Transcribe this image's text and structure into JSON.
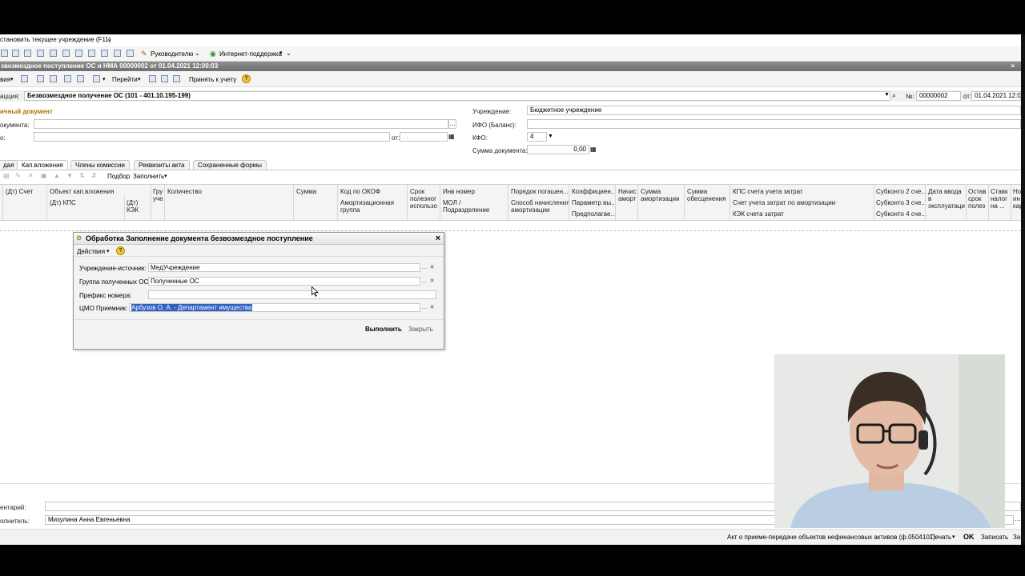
{
  "menu": {
    "restore_institution": "становить текущее учреждение (F11)"
  },
  "toolbar1": {
    "manager": "Руководителю",
    "support": "Интернет-поддержка"
  },
  "document": {
    "title": "звозмездное поступление ОС и НМА 00000002 от 01.04.2021 12:00:03",
    "actions_label": "вия",
    "goto_label": "Перейти",
    "accept_label": "Принять к учету",
    "operation_label": "ацция:",
    "operation_value": "Безвозмездное получение ОС (101 - 401.10.195-199)",
    "number_label": "№:",
    "number_value": "00000002",
    "date_label": "от:",
    "date_value": "01.04.2021 12:00:",
    "primary_doc_section": "ичный документ",
    "doc_label": "окумента:",
    "from_short_label": "о:",
    "from_label": "от:",
    "date_placeholder": ". .",
    "institution_label": "Учреждение:",
    "institution_value": "Бюджетное учреждение",
    "ifo_label": "ИФО (Баланс):",
    "kfo_label": "КФО:",
    "kfo_value": "4",
    "sum_label": "Сумма документа:",
    "sum_value": "0,00"
  },
  "tabs": [
    {
      "label": "дая"
    },
    {
      "label": "Кап.вложения"
    },
    {
      "label": "Члены комиссии"
    },
    {
      "label": "Реквизиты акта"
    },
    {
      "label": "Сохраненные формы"
    }
  ],
  "tabtoolbar": {
    "pick": "Подбор",
    "fill": "Заполнить"
  },
  "grid_headers": {
    "c1a": "(Дт) Счет",
    "c2a": "Объект кап.вложения",
    "c2b": "(Дт) КПС",
    "c3a": "(Дт)",
    "c3b": "КЭК",
    "c4a": "Гру",
    "c4b": "уче",
    "c5a": "Количество",
    "c6a": "Сумма",
    "c7a": "Код по ОКОФ",
    "c7b": "Амортизационная",
    "c7c": "группа",
    "c8a": "Срок",
    "c8b": "полезног",
    "c8c": "использо",
    "c9a": "Инв номер",
    "c9b": "МОЛ /",
    "c9c": "Подразделение",
    "c10a": "Порядок погашен...",
    "c10b": "Способ начисления",
    "c10c": "амортизации",
    "c11a": "Коэффициен...",
    "c11b": "Параметр вы...",
    "c11c": "Предполагае...",
    "c12a": "Начис",
    "c12b": "аморт",
    "c13a": "Сумма",
    "c13b": "амортизации",
    "c14a": "Сумма",
    "c14b": "обесценения",
    "c15a": "КПС счета учета затрат",
    "c15b": "Счет учета затрат по амортизации",
    "c15c": "КЭК счета затрат",
    "c16a": "Субконто 2 сче...",
    "c16b": "Субконто 3 сче...",
    "c16c": "Субконто 4 сче...",
    "c17a": "Дата ввода",
    "c17b": "в",
    "c17c": "эксплуатаци",
    "c18a": "Остав",
    "c18b": "срок",
    "c18c": "полез",
    "c19a": "Ставк",
    "c19b": "налог",
    "c19c": "на ...",
    "c20a": "Но",
    "c20b": "ин",
    "c20c": "кар"
  },
  "dialog": {
    "title": "Обработка  Заполнение документа безвозмездное поступление",
    "actions": "Действия",
    "source_label": "Учреждение-источник:",
    "source_value": "МедУчреждение",
    "group_label": "Группа полученных ОС:",
    "group_value": "Полученные ОС",
    "prefix_label": "Префикс номера:",
    "prefix_value": "",
    "cmo_label": "ЦМО Приемник:",
    "cmo_value": "Арбузов О. А. - Департамент имущества",
    "execute": "Выполнить",
    "close": "Закрыть"
  },
  "footer": {
    "comment_label": "ентарий:",
    "executor_label": "олнитель:",
    "executor_value": "Мизулина Анна Евгеньевна"
  },
  "statusbar": {
    "act": "Акт о приеме-передаче объектов нефинансовых активов (ф.0504101)",
    "print": "Печать",
    "ok": "OK",
    "save": "Записать",
    "close_short": "За"
  }
}
